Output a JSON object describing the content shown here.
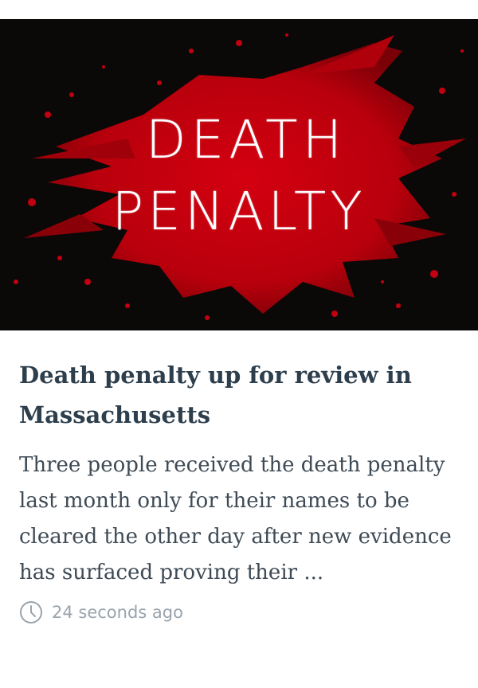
{
  "article": {
    "image": {
      "line1": "DEATH",
      "line2": "PENALTY",
      "background_color": "#0b0808",
      "splash_color": "#c4000c"
    },
    "headline": "Death penalty up for review in Massachusetts",
    "summary": "Three people received the death penalty last month only for their names to be cleared the other day after new evidence has surfaced proving their ...",
    "timestamp": "24 seconds ago",
    "timestamp_icon": "clock-icon"
  }
}
